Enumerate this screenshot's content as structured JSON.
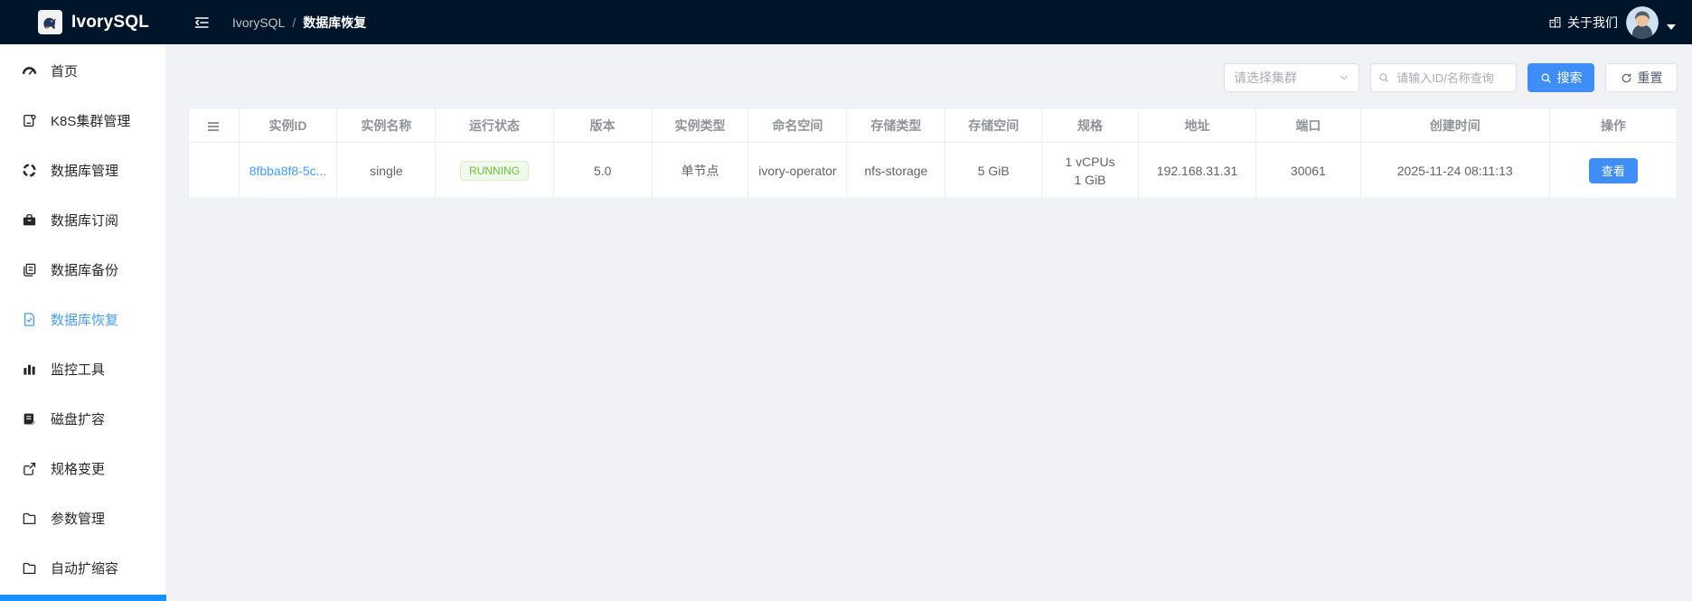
{
  "navbar": {
    "brand": "IvorySQL",
    "breadcrumb": {
      "root": "IvorySQL",
      "separator": "/",
      "current": "数据库恢复"
    },
    "about_label": "关于我们"
  },
  "sidebar": {
    "items": [
      {
        "label": "首页",
        "icon": "dashboard",
        "active": false
      },
      {
        "label": "K8S集群管理",
        "icon": "cluster-profile",
        "active": false
      },
      {
        "label": "数据库管理",
        "icon": "database-ring",
        "active": false
      },
      {
        "label": "数据库订阅",
        "icon": "subscription-briefcase",
        "active": false
      },
      {
        "label": "数据库备份",
        "icon": "backup-copy",
        "active": false
      },
      {
        "label": "数据库恢复",
        "icon": "restore-file-check",
        "active": true
      },
      {
        "label": "监控工具",
        "icon": "bar-chart",
        "active": false
      },
      {
        "label": "磁盘扩容",
        "icon": "disk-edit",
        "active": false
      },
      {
        "label": "规格变更",
        "icon": "spec-export",
        "active": false
      },
      {
        "label": "参数管理",
        "icon": "folder",
        "active": false
      },
      {
        "label": "自动扩缩容",
        "icon": "folder",
        "active": false
      }
    ]
  },
  "filters": {
    "cluster_select_placeholder": "请选择集群",
    "search_input_placeholder": "请输入ID/名称查询",
    "search_button_label": "搜索",
    "reset_button_label": "重置"
  },
  "table": {
    "columns": [
      "",
      "实例ID",
      "实例名称",
      "运行状态",
      "版本",
      "实例类型",
      "命名空间",
      "存储类型",
      "存储空间",
      "规格",
      "地址",
      "端口",
      "创建时间",
      "操作"
    ],
    "rows": [
      {
        "instance_id": "8fbba8f8-5c...",
        "instance_name": "single",
        "status": "RUNNING",
        "version": "5.0",
        "instance_type": "单节点",
        "namespace": "ivory-operator",
        "storage_type": "nfs-storage",
        "storage_size": "5 GiB",
        "spec_line1": "1 vCPUs",
        "spec_line2": "1 GiB",
        "address": "192.168.31.31",
        "port": "30061",
        "created_at": "2025-11-24 08:11:13",
        "action_label": "查看"
      }
    ]
  },
  "colors": {
    "navbar_bg": "#001529",
    "primary_blue": "#3f8ef7",
    "link_blue": "#409eff",
    "active_menu_blue": "#4a9cf8",
    "success_green": "#67c23a",
    "success_bg": "#f0f9eb",
    "content_bg": "#f0f2f5"
  }
}
